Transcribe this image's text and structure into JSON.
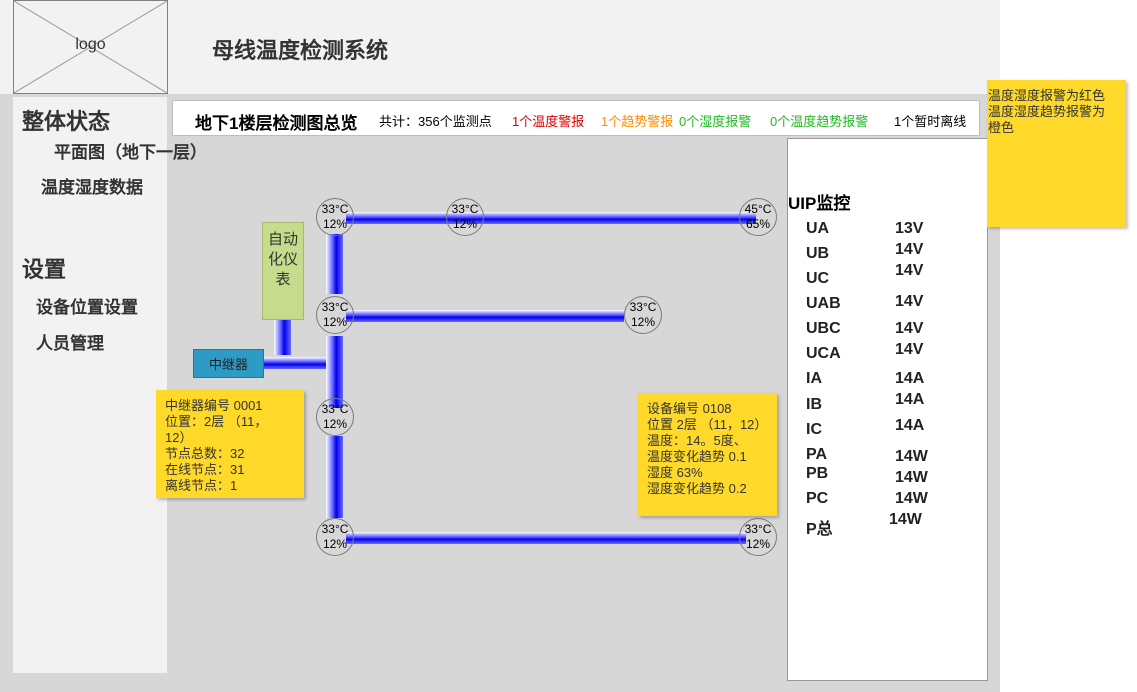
{
  "app": {
    "logo_text": "logo",
    "title": "母线温度检测系统"
  },
  "sidebar": {
    "overall_heading": "整体状态",
    "items": [
      "平面图（地下一层）",
      "温度湿度数据"
    ],
    "settings_heading": "设置",
    "settings_items": [
      "设备位置设置",
      "人员管理"
    ]
  },
  "overview": {
    "title": "地下1楼层检测图总览",
    "total": "共计：356个监测点",
    "temp_alarm": "1个温度警报",
    "trend_alarm": "1个趋势警报",
    "humidity_alarm": "0个湿度报警",
    "humidity_trend_alarm": "0个温度趋势报警",
    "offline": "1个暂时离线"
  },
  "colors": {
    "alarm_red": "#e00000",
    "trend_orange": "#ff8c00",
    "ok_green": "#22bb22",
    "note_yellow": "#fed92a",
    "pipe_blue": "#0000ee"
  },
  "nodes": [
    {
      "temp": "33°C",
      "humidity": "12%",
      "status": "green"
    },
    {
      "temp": "33°C",
      "humidity": "12%",
      "status": "green"
    },
    {
      "temp": "45°C",
      "humidity": "65%",
      "status": "red"
    },
    {
      "temp": "33°C",
      "humidity": "12%",
      "status": "green"
    },
    {
      "temp": "33°C",
      "humidity": "12%",
      "status": "yellow"
    },
    {
      "temp": "33°C",
      "humidity": "12%",
      "status": "green"
    },
    {
      "temp": "33°C",
      "humidity": "12%",
      "status": "green"
    },
    {
      "temp": "33°C",
      "humidity": "12%",
      "status": "green"
    }
  ],
  "instrument_label": "自动化仪表",
  "repeater_label": "中继器",
  "repeater_info": {
    "lines": [
      "中继器编号 0001",
      "位置：2层 （11，",
      "12）",
      "节点总数：32",
      "在线节点：31",
      "离线节点：1"
    ]
  },
  "device_info": {
    "lines": [
      "设备编号 0108",
      "位置 2层 （11，12）",
      "温度：14。5度、",
      "温度变化趋势 0.1",
      "湿度 63%",
      "湿度变化趋势 0.2"
    ]
  },
  "alarm_note": {
    "lines": [
      "温度湿度报警为红色",
      "温度湿度趋势报警为",
      "橙色"
    ]
  },
  "uip": {
    "title": "UIP监控",
    "labels": [
      "UA",
      "UB",
      "UC",
      "UAB",
      "UBC",
      "UCA",
      "IA",
      "IB",
      "IC",
      "PA",
      "PB",
      "PC",
      "P总"
    ],
    "values": [
      "13V",
      "14V",
      "14V",
      "14V",
      "14V",
      "14V",
      "14A",
      "14A",
      "14A",
      "14W",
      "14W",
      "14W",
      "14W"
    ]
  }
}
